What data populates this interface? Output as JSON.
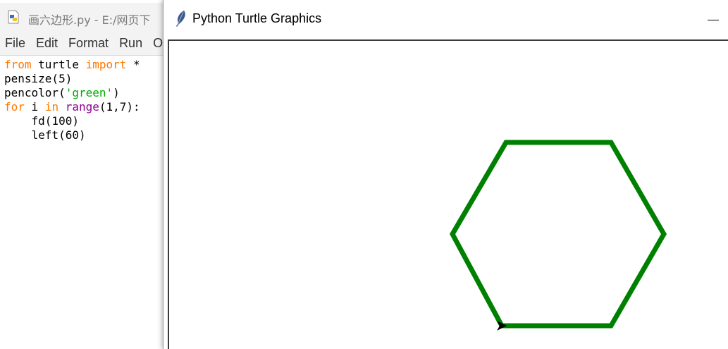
{
  "idle": {
    "title": "画六边形.py - E:/网页下",
    "menu": [
      "File",
      "Edit",
      "Format",
      "Run",
      "O"
    ],
    "code_lines": [
      [
        {
          "t": "from",
          "c": "kw"
        },
        {
          "t": " turtle ",
          "c": ""
        },
        {
          "t": "import",
          "c": "kw"
        },
        {
          "t": " *",
          "c": ""
        }
      ],
      [
        {
          "t": "pensize(5)",
          "c": ""
        }
      ],
      [
        {
          "t": "pencolor(",
          "c": ""
        },
        {
          "t": "'green'",
          "c": "str"
        },
        {
          "t": ")",
          "c": ""
        }
      ],
      [
        {
          "t": "for",
          "c": "kw"
        },
        {
          "t": " i ",
          "c": ""
        },
        {
          "t": "in",
          "c": "kw"
        },
        {
          "t": " ",
          "c": ""
        },
        {
          "t": "range",
          "c": "bi"
        },
        {
          "t": "(1,7):",
          "c": ""
        }
      ],
      [
        {
          "t": "    fd(100)",
          "c": ""
        }
      ],
      [
        {
          "t": "    left(60)",
          "c": ""
        }
      ]
    ]
  },
  "turtle": {
    "title": "Python Turtle Graphics",
    "pen_color": "#008000",
    "pen_size": 5
  }
}
